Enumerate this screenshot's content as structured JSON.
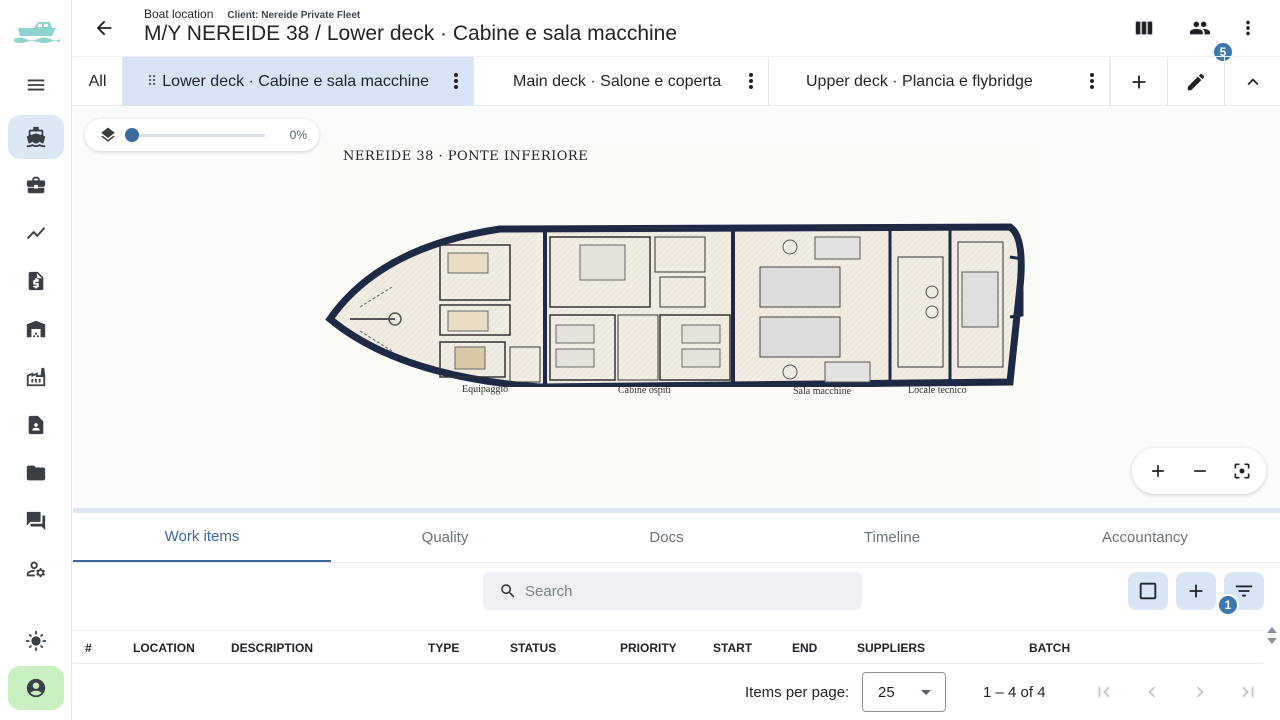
{
  "header": {
    "breadcrumb": "Boat location",
    "client": "Client: Nereide Private Fleet",
    "title": "M/Y NEREIDE 38 / Lower deck · Cabine e sala macchine",
    "members_badge": "5"
  },
  "rail": {
    "items": [
      "menu-icon",
      "boat-icon",
      "briefcase-icon",
      "trending-icon",
      "invoice-icon",
      "warehouse-icon",
      "factory-icon",
      "contact-icon",
      "folder-icon",
      "chat-icon",
      "user-settings-icon",
      "brightness-icon",
      "account-icon"
    ],
    "active": "boat-icon"
  },
  "decks": {
    "all_label": "All",
    "tabs": [
      {
        "label": "Lower deck · Cabine e sala macchine",
        "selected": true
      },
      {
        "label": "Main deck · Salone e coperta",
        "selected": false
      },
      {
        "label": "Upper deck · Plancia e flybridge",
        "selected": false
      }
    ]
  },
  "viewer": {
    "layer_opacity_label": "0%",
    "layer_opacity": 0,
    "plan_title": "NEREIDE 38 · PONTE INFERIORE",
    "zones": [
      "Equipaggio",
      "Cabine ospiti",
      "Sala macchine",
      "Locale tecnico"
    ]
  },
  "lower_tabs": [
    "Work items",
    "Quality",
    "Docs",
    "Timeline",
    "Accountancy"
  ],
  "active_lower_tab": "Work items",
  "toolbar": {
    "search_placeholder": "Search",
    "filter_badge": "1"
  },
  "table": {
    "columns": [
      "#",
      "LOCATION",
      "DESCRIPTION",
      "TYPE",
      "STATUS",
      "PRIORITY",
      "START",
      "END",
      "SUPPLIERS",
      "BATCH"
    ]
  },
  "paginator": {
    "items_per_page_label": "Items per page:",
    "page_size": "25",
    "range": "1 – 4 of 4"
  },
  "colors": {
    "accent": "#3d6a9e",
    "selected_bg": "#d7e5f6",
    "badge": "#3d78b0",
    "hull": "#1e2a45",
    "profile_bg": "#c9f0c0"
  }
}
